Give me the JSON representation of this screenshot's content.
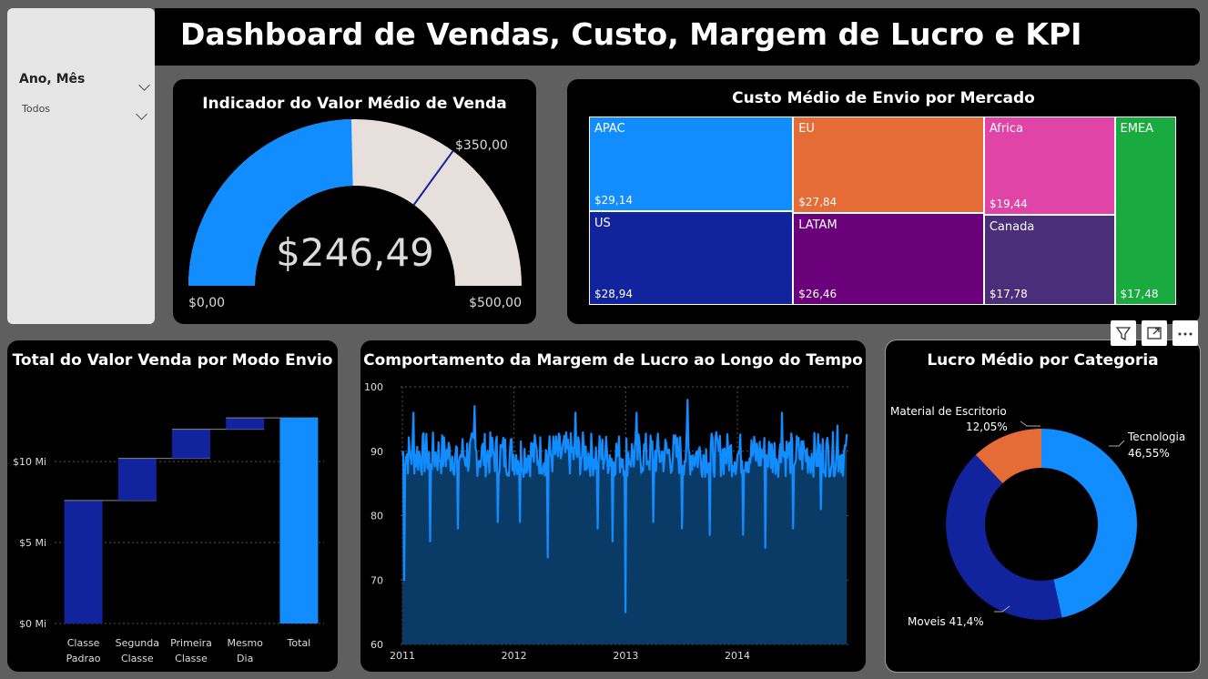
{
  "slicer": {
    "label": "Ano, Mês",
    "value": "Todos"
  },
  "dashboard_title": "Dashboard de Vendas, Custo, Margem de Lucro e KPI",
  "gauge": {
    "title": "Indicador do Valor Médio de Venda",
    "value_label": "$246,49",
    "value": 246.49,
    "min": 0,
    "max": 500,
    "target": 350,
    "min_label": "$0,00",
    "max_label": "$500,00",
    "target_label": "$350,00",
    "fill_color": "#118DFF",
    "track_color": "#E6DFDB",
    "target_color": "#12239E"
  },
  "treemap": {
    "title": "Custo Médio de Envio por Mercado",
    "items": [
      {
        "name": "APAC",
        "value_label": "$29,14",
        "value": 29.14,
        "color": "#118DFF"
      },
      {
        "name": "US",
        "value_label": "$28,94",
        "value": 28.94,
        "color": "#12239E"
      },
      {
        "name": "EU",
        "value_label": "$27,84",
        "value": 27.84,
        "color": "#E66C37"
      },
      {
        "name": "LATAM",
        "value_label": "$26,46",
        "value": 26.46,
        "color": "#6B007B"
      },
      {
        "name": "Africa",
        "value_label": "$19,44",
        "value": 19.44,
        "color": "#E044A7"
      },
      {
        "name": "Canada",
        "value_label": "$17,78",
        "value": 17.78,
        "color": "#4A2E7A"
      },
      {
        "name": "EMEA",
        "value_label": "$17,48",
        "value": 17.48,
        "color": "#1AAB40"
      }
    ]
  },
  "waterfall": {
    "title": "Total do Valor Venda por Modo Envio",
    "ticks": [
      {
        "v": 0,
        "label": "$0 Mi"
      },
      {
        "v": 5,
        "label": "$5 Mi"
      },
      {
        "v": 10,
        "label": "$10 Mi"
      }
    ]
  },
  "line": {
    "title": "Comportamento da Margem de Lucro ao Longo do Tempo",
    "y_ticks": [
      "100",
      "90",
      "80",
      "70",
      "60"
    ],
    "x_ticks": [
      "2011",
      "2012",
      "2013",
      "2014"
    ]
  },
  "donut": {
    "title": "Lucro Médio por Categoria",
    "labels": [
      {
        "line1": "Tecnologia",
        "line2": "46,55%"
      },
      {
        "line1": "Moveis 41,4%",
        "line2": ""
      },
      {
        "line1": "Material de Escritorio",
        "line2": "12,05%"
      }
    ]
  },
  "visual_header": {
    "filter_icon": "filter-icon",
    "focus_icon": "focus-mode-icon",
    "more_icon": "more-options-icon"
  },
  "chart_data": [
    {
      "type": "gauge",
      "title": "Indicador do Valor Médio de Venda",
      "value": 246.49,
      "min": 0,
      "max": 500,
      "target": 350
    },
    {
      "type": "treemap",
      "title": "Custo Médio de Envio por Mercado",
      "categories": [
        "APAC",
        "US",
        "EU",
        "LATAM",
        "Africa",
        "Canada",
        "EMEA"
      ],
      "values": [
        29.14,
        28.94,
        27.84,
        26.46,
        19.44,
        17.78,
        17.48
      ]
    },
    {
      "type": "bar",
      "title": "Total do Valor Venda por Modo Envio",
      "categories": [
        "Classe Padrao",
        "Segunda Classe",
        "Primeira Classe",
        "Mesmo Dia",
        "Total"
      ],
      "category_lines": [
        [
          "Classe",
          "Padrao"
        ],
        [
          "Segunda",
          "Classe"
        ],
        [
          "Primeira",
          "Classe"
        ],
        [
          "Mesmo",
          "Dia"
        ],
        [
          "Total",
          ""
        ]
      ],
      "values": [
        7.6,
        2.6,
        1.8,
        0.7,
        12.7
      ],
      "ylim": [
        0,
        14
      ],
      "bar_color": "#12239E",
      "total_color": "#118DFF"
    },
    {
      "type": "area",
      "title": "Comportamento da Margem de Lucro ao Longo do Tempo",
      "ylim": [
        60,
        100
      ],
      "x_range": [
        "2011",
        "2014"
      ],
      "typical_value": 89.5,
      "spikes": [
        {
          "x": 2011.02,
          "y": 70
        },
        {
          "x": 2011.1,
          "y": 96
        },
        {
          "x": 2011.25,
          "y": 76
        },
        {
          "x": 2011.5,
          "y": 78
        },
        {
          "x": 2011.65,
          "y": 97
        },
        {
          "x": 2011.85,
          "y": 79
        },
        {
          "x": 2012.05,
          "y": 79
        },
        {
          "x": 2012.3,
          "y": 73.5
        },
        {
          "x": 2012.55,
          "y": 96
        },
        {
          "x": 2012.75,
          "y": 78
        },
        {
          "x": 2012.88,
          "y": 76
        },
        {
          "x": 2013.0,
          "y": 65
        },
        {
          "x": 2013.1,
          "y": 96
        },
        {
          "x": 2013.25,
          "y": 79
        },
        {
          "x": 2013.5,
          "y": 78
        },
        {
          "x": 2013.55,
          "y": 98
        },
        {
          "x": 2013.75,
          "y": 77
        },
        {
          "x": 2014.05,
          "y": 77
        },
        {
          "x": 2014.25,
          "y": 75
        },
        {
          "x": 2014.4,
          "y": 96
        },
        {
          "x": 2014.5,
          "y": 78
        },
        {
          "x": 2014.75,
          "y": 81
        },
        {
          "x": 2014.9,
          "y": 94
        }
      ],
      "line_color": "#118DFF",
      "fill_color": "#0A3A66"
    },
    {
      "type": "pie",
      "title": "Lucro Médio por Categoria",
      "categories": [
        "Tecnologia",
        "Moveis",
        "Material de Escritorio"
      ],
      "values": [
        46.55,
        41.4,
        12.05
      ],
      "colors": [
        "#118DFF",
        "#12239E",
        "#E66C37"
      ]
    }
  ]
}
